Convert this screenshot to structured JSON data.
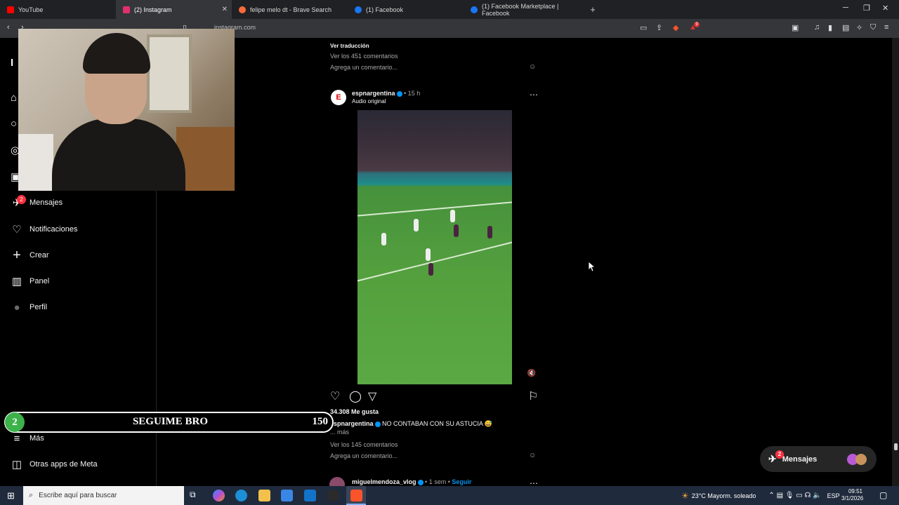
{
  "browser": {
    "tabs": [
      {
        "label": "YouTube",
        "color": "#ff0000",
        "active": false
      },
      {
        "label": "(2) Instagram",
        "color": "#e1306c",
        "active": true
      },
      {
        "label": "felipe melo dt - Brave Search",
        "color": "#ff6a3d",
        "active": false
      },
      {
        "label": "(1) Facebook",
        "color": "#1877f2",
        "active": false
      },
      {
        "label": "(1) Facebook Marketplace | Facebook",
        "color": "#1877f2",
        "active": false
      }
    ],
    "new_tab": "+",
    "url": "instagram.com",
    "brave_badge": "9"
  },
  "sidebar": {
    "items": [
      {
        "label": "Mensajes",
        "icon": "messenger-icon",
        "glyph": "✈"
      },
      {
        "label": "Notificaciones",
        "icon": "heart-icon",
        "glyph": "♡"
      },
      {
        "label": "Crear",
        "icon": "plus-icon",
        "glyph": "+"
      },
      {
        "label": "Panel",
        "icon": "chart-icon",
        "glyph": "▥"
      },
      {
        "label": "Perfil",
        "icon": "avatar-icon",
        "glyph": "●"
      },
      {
        "label": "Más",
        "icon": "menu-icon",
        "glyph": "≡"
      },
      {
        "label": "Otras apps de Meta",
        "icon": "meta-apps-icon",
        "glyph": "◫"
      }
    ],
    "messages_badge": "2"
  },
  "feed": {
    "prev_post": {
      "translate": "Ver traducción",
      "view_comments": "Ver los 451 comentarios",
      "add_comment": "Agrega un comentario..."
    },
    "post": {
      "username": "espnargentina",
      "time": "• 15 h",
      "audio": "Audio original",
      "likes": "34.308 Me gusta",
      "caption_user": "espnargentina",
      "caption": "NO CONTABAN CON SU ASTUCIA 😅",
      "more": "... más",
      "view_comments": "Ver los 145 comentarios",
      "add_comment": "Agrega un comentario..."
    },
    "next_post": {
      "username": "miguelmendoza_vlog",
      "time": "• 1 sem •",
      "follow": "Seguir"
    }
  },
  "overlay": {
    "number": "2",
    "label": "SEGUIME BRO",
    "count": "150"
  },
  "messages_pill": {
    "label": "Mensajes",
    "badge": "2"
  },
  "taskbar": {
    "search_placeholder": "Escribe aquí para buscar",
    "weather": "23°C  Mayorm. soleado",
    "language": "ESP",
    "time": "09:51",
    "date": "3/1/2026"
  }
}
